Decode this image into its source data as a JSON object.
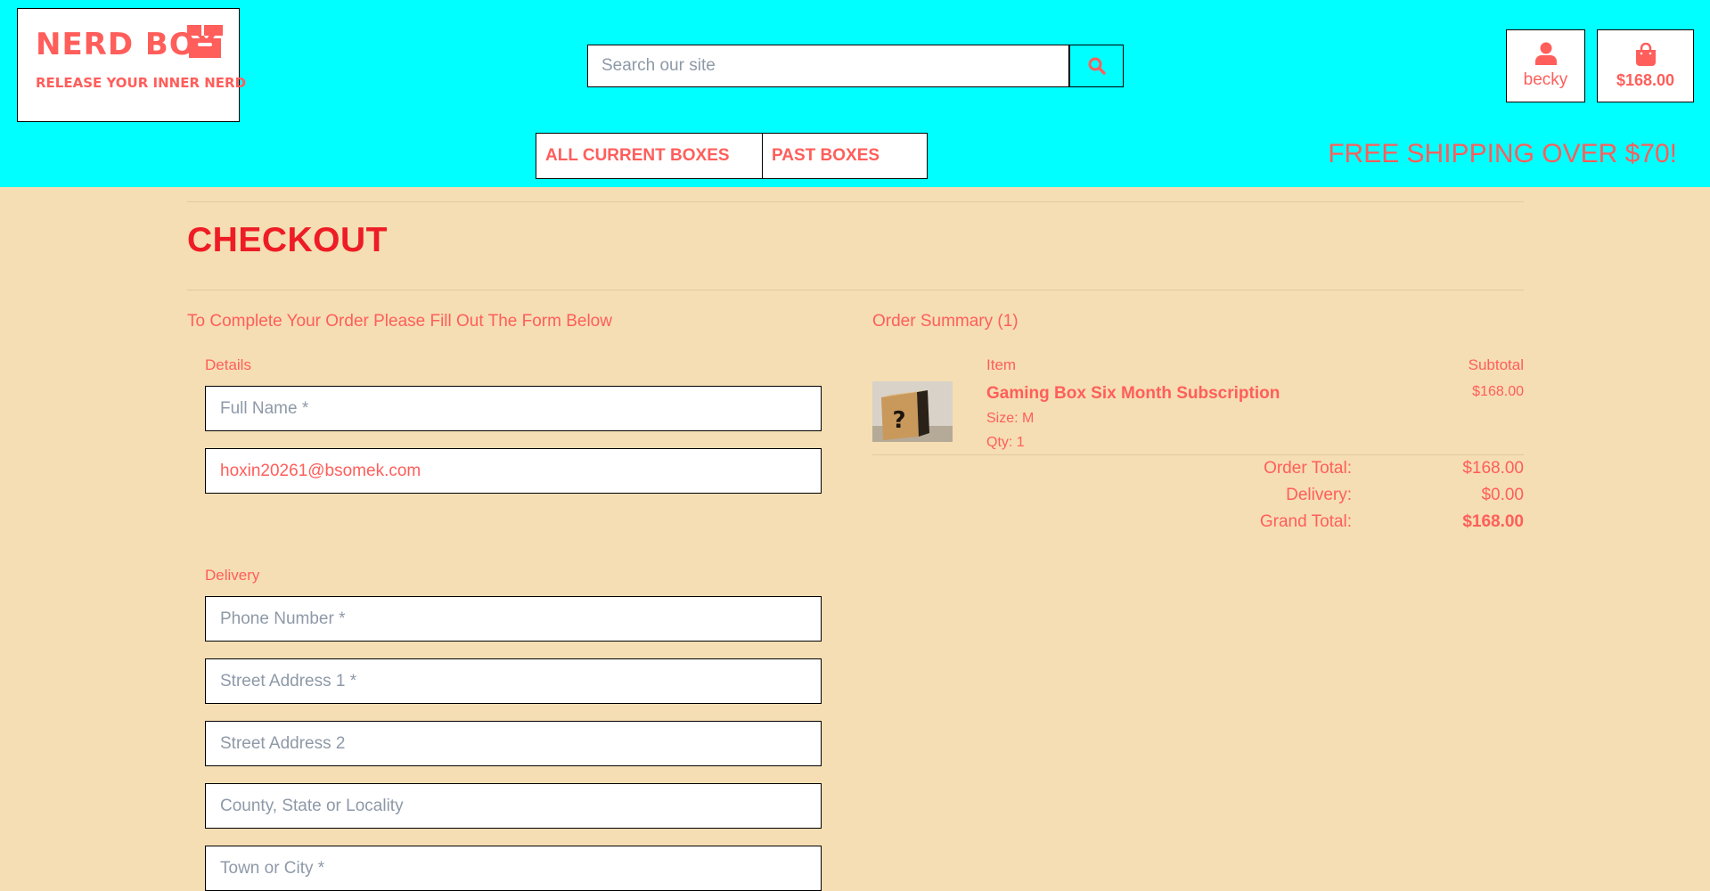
{
  "brand": {
    "name": "NERD BOX",
    "tagline": "RELEASE YOUR INNER NERD",
    "icon": "box-icon"
  },
  "search": {
    "placeholder": "Search our site",
    "button_icon": "search-icon"
  },
  "account": {
    "icon": "user-icon",
    "label": "becky"
  },
  "cart": {
    "icon": "shopping-bag-icon",
    "total": "$168.00"
  },
  "nav": {
    "items": [
      {
        "label": "ALL CURRENT BOXES"
      },
      {
        "label": "PAST BOXES"
      }
    ]
  },
  "promo": "FREE SHIPPING OVER $70!",
  "colors": {
    "header_bg": "#00ffff",
    "page_bg": "#f5deb3",
    "accent": "#ff5e5b",
    "title_red": "#ee1c25"
  },
  "checkout": {
    "title": "CHECKOUT",
    "form_intro": "To Complete Your Order Please Fill Out The Form Below",
    "details": {
      "label": "Details",
      "full_name_placeholder": "Full Name *",
      "email_value": "hoxin20261@bsomek.com"
    },
    "delivery": {
      "label": "Delivery",
      "phone_placeholder": "Phone Number *",
      "street1_placeholder": "Street Address 1 *",
      "street2_placeholder": "Street Address 2",
      "county_placeholder": "County, State or Locality",
      "town_placeholder": "Town or City *"
    }
  },
  "summary": {
    "heading": "Order Summary (1)",
    "columns": {
      "item": "Item",
      "subtotal": "Subtotal"
    },
    "items": [
      {
        "name": "Gaming Box Six Month Subscription",
        "size": "Size: M",
        "qty": "Qty: 1",
        "subtotal": "$168.00",
        "image": "mystery-box-image"
      }
    ],
    "totals": {
      "order_total_label": "Order Total:",
      "order_total": "$168.00",
      "delivery_label": "Delivery:",
      "delivery": "$0.00",
      "grand_total_label": "Grand Total:",
      "grand_total": "$168.00"
    }
  }
}
